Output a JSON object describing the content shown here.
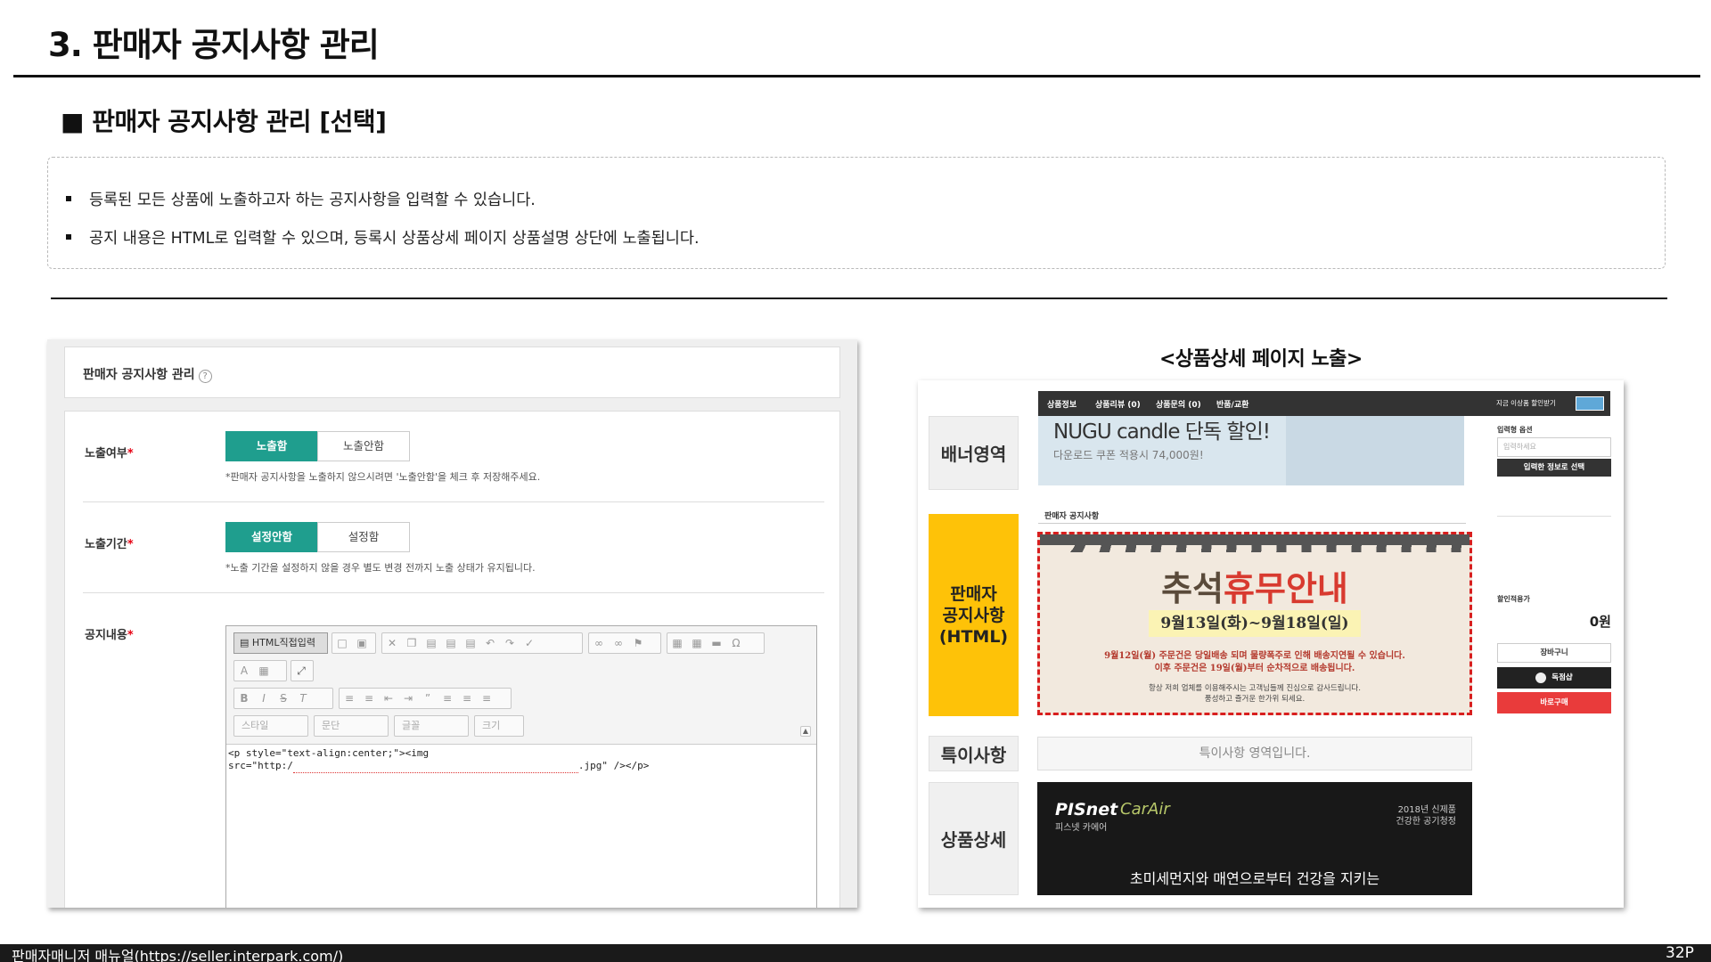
{
  "header": {
    "title": "3. 판매자 공지사항 관리",
    "section_title": "■ 판매자 공지사항 관리 [선택]"
  },
  "description": {
    "items": [
      "등록된 모든 상품에 노출하고자 하는 공지사항을 입력할 수 있습니다.",
      "공지 내용은 HTML로 입력할 수 있으며, 등록시 상품상세 페이지 상품설명 상단에 노출됩니다."
    ]
  },
  "admin_form": {
    "panel_title": "판매자 공지사항 관리",
    "help_icon": "question-circle-icon",
    "exposure": {
      "label": "노출여부",
      "options": [
        "노출함",
        "노출안함"
      ],
      "selected": "노출함",
      "hint": "*판매자 공지사항을 노출하지 않으시려면 '노출안함'을 체크 후 저장해주세요."
    },
    "period": {
      "label": "노출기간",
      "options": [
        "설정안함",
        "설정함"
      ],
      "selected": "설정안함",
      "hint": "*노출 기간을 설정하지 않을 경우 별도 변경 전까지 노출 상태가 유지됩니다."
    },
    "content": {
      "label": "공지내용",
      "html_button": "HTML직접입력",
      "dropdowns": [
        "스타일",
        "문단",
        "글꼴",
        "크기"
      ],
      "code_line1": "<p style=\"text-align:center;\"><img",
      "code_line2_prefix": "src=\"http:/",
      "code_line2_suffix": ".jpg\" /></p>"
    },
    "required_mark": "*"
  },
  "preview": {
    "title": "<상품상세 페이지 노출>",
    "labels": {
      "banner": "배너영역",
      "notice": "판매자\n공지사항\n(HTML)",
      "special": "특이사항",
      "detail": "상품상세"
    },
    "nav_tabs": [
      "상품정보",
      "상품리뷰 (0)",
      "상품문의 (0)",
      "반품/교환"
    ],
    "nav_right": "지금 이상품 할인받기",
    "banner": {
      "headline": "NUGU candle 단독 할인!",
      "sub": "다운로드 쿠폰 적용시 74,000원!"
    },
    "notice_small_label": "판매자 공지사항",
    "notice_image": {
      "title_a": "추석",
      "title_b": "휴무안내",
      "date": "9월13일(화)~9월18일(일)",
      "line1": "9월12일(월) 주문건은 당일배송 되며 물량폭주로 인해 배송지연될 수 있습니다.",
      "line2": "이후 주문건은 19일(월)부터 순차적으로 배송됩니다.",
      "line3": "항상 저희 업체를 이용해주시는 고객님들께 진심으로 감사드립니다.",
      "line4": "풍성하고 즐거운 한가위 되세요."
    },
    "special_text": "특이사항 영역입니다.",
    "detail_image": {
      "brand": "PISnet",
      "brand_sub": "CarAir",
      "brand_kr": "피스넷 카에어",
      "right_top": "2018년 신제품",
      "right_bottom": "건강한 공기청정",
      "main": "초미세먼지와 매연으로부터 건강을 지키는"
    },
    "sidebar": {
      "option_label": "입력형 옵션",
      "input_placeholder": "입력하세요",
      "confirm_button": "입력한 정보로 선택",
      "total_label": "할인적용가",
      "total_value": "0원",
      "cart_button": "장바구니",
      "gift_button": "독점샵",
      "buy_button": "바로구매"
    }
  },
  "footer": {
    "text": "판매자매니저 매뉴얼(https://seller.interpark.com/)",
    "page": "32P"
  },
  "colors": {
    "accent_green": "#1f9e8e",
    "notice_yellow": "#fec208",
    "dash_red": "#d81e1e",
    "buy_red": "#e93b3b"
  }
}
